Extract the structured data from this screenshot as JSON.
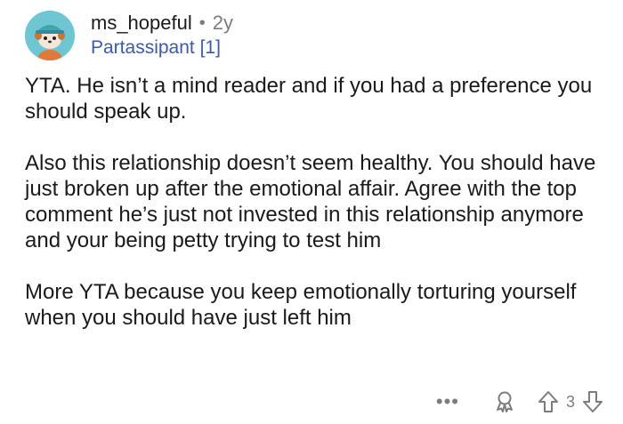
{
  "comment": {
    "author": "ms_hopeful",
    "separator": "•",
    "age": "2y",
    "flair": "Partassipant [1]",
    "paragraphs": [
      "YTA. He isn’t a mind reader and if you had a preference you should speak up.",
      "Also this relationship doesn’t seem healthy. You should have just broken up after the emotional affair. Agree with the top comment he’s just not invested in this relationship anymore and your being petty trying to test him",
      "More YTA because you keep emotionally torturing yourself when you should have just left him"
    ],
    "score": "3"
  },
  "actions": {
    "more_label": "•••",
    "icons": {
      "award": "award-icon",
      "upvote": "upvote-arrow-icon",
      "downvote": "downvote-arrow-icon"
    }
  },
  "colors": {
    "text": "#1a1a1b",
    "muted": "#7c7c7c",
    "flair": "#3d5aa8",
    "avatar_bg": "#6ec6d3"
  }
}
